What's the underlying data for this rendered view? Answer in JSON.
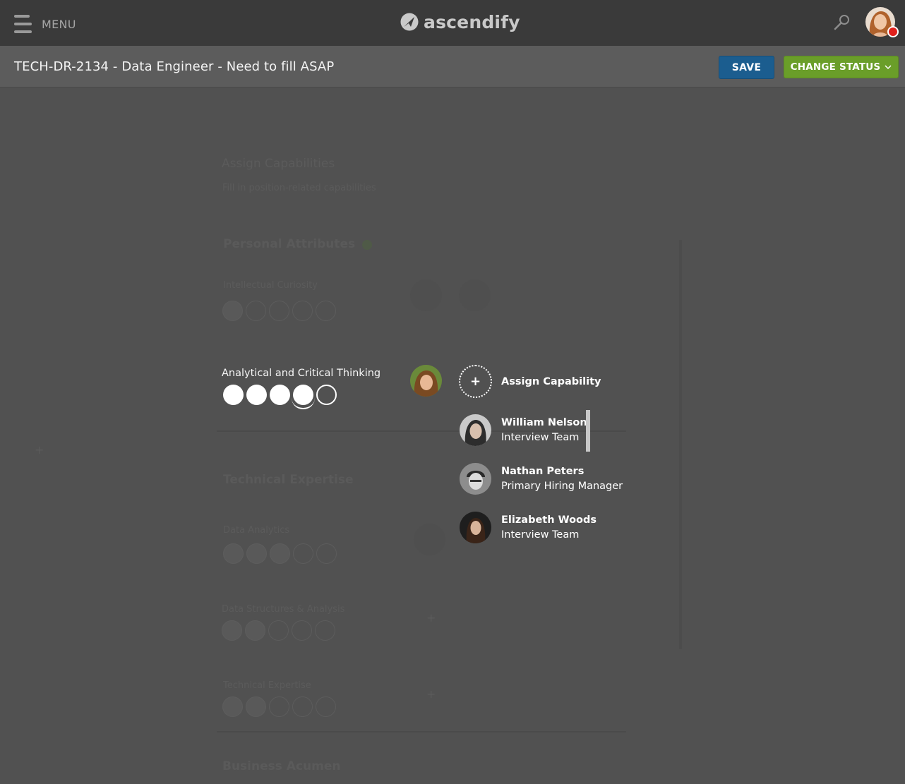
{
  "header": {
    "menu_label": "MENU",
    "logo_text": "ascendify",
    "search_icon": "search-icon",
    "avatar_icon": "user-avatar",
    "status_color": "#e0201c"
  },
  "subheader": {
    "title": "TECH-DR-2134 - Data Engineer - Need to fill ASAP",
    "save_label": "SAVE",
    "change_status_label": "CHANGE STATUS",
    "save_color": "#1b5d8f",
    "status_color": "#6a9e29"
  },
  "background": {
    "heading": "Assign Capabilities",
    "subheading": "Fill in position-related capabilities",
    "sections": [
      {
        "title": "Personal Attributes",
        "items": [
          {
            "label": "Intellectual Curiosity",
            "rating": 1
          }
        ]
      },
      {
        "title": "Technical Expertise",
        "items": [
          {
            "label": "Data Analytics",
            "rating": 3
          },
          {
            "label": "Data Structures & Analysis",
            "rating": 2
          },
          {
            "label": "Technical Expertise",
            "rating": 2
          }
        ]
      },
      {
        "title": "Business Acumen",
        "items": []
      }
    ]
  },
  "active_capability": {
    "label": "Analytical and Critical Thinking",
    "rating": 4,
    "max": 5
  },
  "assign_menu": {
    "assign_label": "Assign Capability",
    "people": [
      {
        "name": "William Nelson",
        "role": "Interview Team"
      },
      {
        "name": "Nathan Peters",
        "role": "Primary Hiring Manager"
      },
      {
        "name": "Elizabeth Woods",
        "role": "Interview Team"
      }
    ]
  }
}
